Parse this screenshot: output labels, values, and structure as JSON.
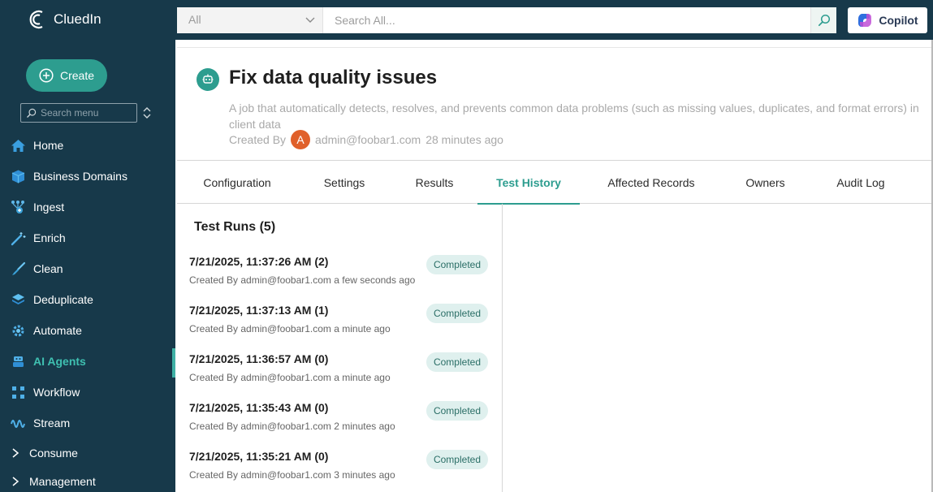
{
  "app": {
    "name": "CluedIn"
  },
  "search": {
    "scope": "All",
    "placeholder": "Search All..."
  },
  "copilot": {
    "label": "Copilot"
  },
  "sidebar": {
    "create_label": "Create",
    "menu_search_placeholder": "Search menu",
    "items": [
      {
        "label": "Home",
        "icon": "home-icon"
      },
      {
        "label": "Business Domains",
        "icon": "cube-icon"
      },
      {
        "label": "Ingest",
        "icon": "ingest-icon"
      },
      {
        "label": "Enrich",
        "icon": "wand-icon"
      },
      {
        "label": "Clean",
        "icon": "brush-icon"
      },
      {
        "label": "Deduplicate",
        "icon": "layers-icon"
      },
      {
        "label": "Automate",
        "icon": "gear-icon"
      },
      {
        "label": "AI Agents",
        "icon": "robot-icon",
        "active": true
      },
      {
        "label": "Workflow",
        "icon": "workflow-icon"
      },
      {
        "label": "Stream",
        "icon": "stream-icon"
      }
    ],
    "groups": [
      {
        "label": "Consume"
      },
      {
        "label": "Management"
      }
    ]
  },
  "page": {
    "title": "Fix data quality issues",
    "description": "A job that automatically detects, resolves, and prevents common data problems (such as missing values, duplicates, and format errors) in client data",
    "created_by_label": "Created By",
    "avatar_letter": "A",
    "author": "admin@foobar1.com",
    "time": "28 minutes ago"
  },
  "tabs": [
    {
      "label": "Configuration"
    },
    {
      "label": "Settings"
    },
    {
      "label": "Results"
    },
    {
      "label": "Test History",
      "active": true
    },
    {
      "label": "Affected Records"
    },
    {
      "label": "Owners"
    },
    {
      "label": "Audit Log"
    }
  ],
  "test_runs": {
    "title": "Test Runs (5)",
    "runs": [
      {
        "date": "7/21/2025, 11:37:26 AM (2)",
        "meta": "Created By admin@foobar1.com a few seconds ago",
        "status": "Completed"
      },
      {
        "date": "7/21/2025, 11:37:13 AM (1)",
        "meta": "Created By admin@foobar1.com a minute ago",
        "status": "Completed"
      },
      {
        "date": "7/21/2025, 11:36:57 AM (0)",
        "meta": "Created By admin@foobar1.com a minute ago",
        "status": "Completed"
      },
      {
        "date": "7/21/2025, 11:35:43 AM (0)",
        "meta": "Created By admin@foobar1.com 2 minutes ago",
        "status": "Completed"
      },
      {
        "date": "7/21/2025, 11:35:21 AM (0)",
        "meta": "Created By admin@foobar1.com 3 minutes ago",
        "status": "Completed"
      }
    ]
  },
  "colors": {
    "sidebar_bg": "#17394a",
    "accent": "#2d9d8f",
    "active_nav": "#3fc0b1",
    "badge_bg": "#dff0ee"
  }
}
